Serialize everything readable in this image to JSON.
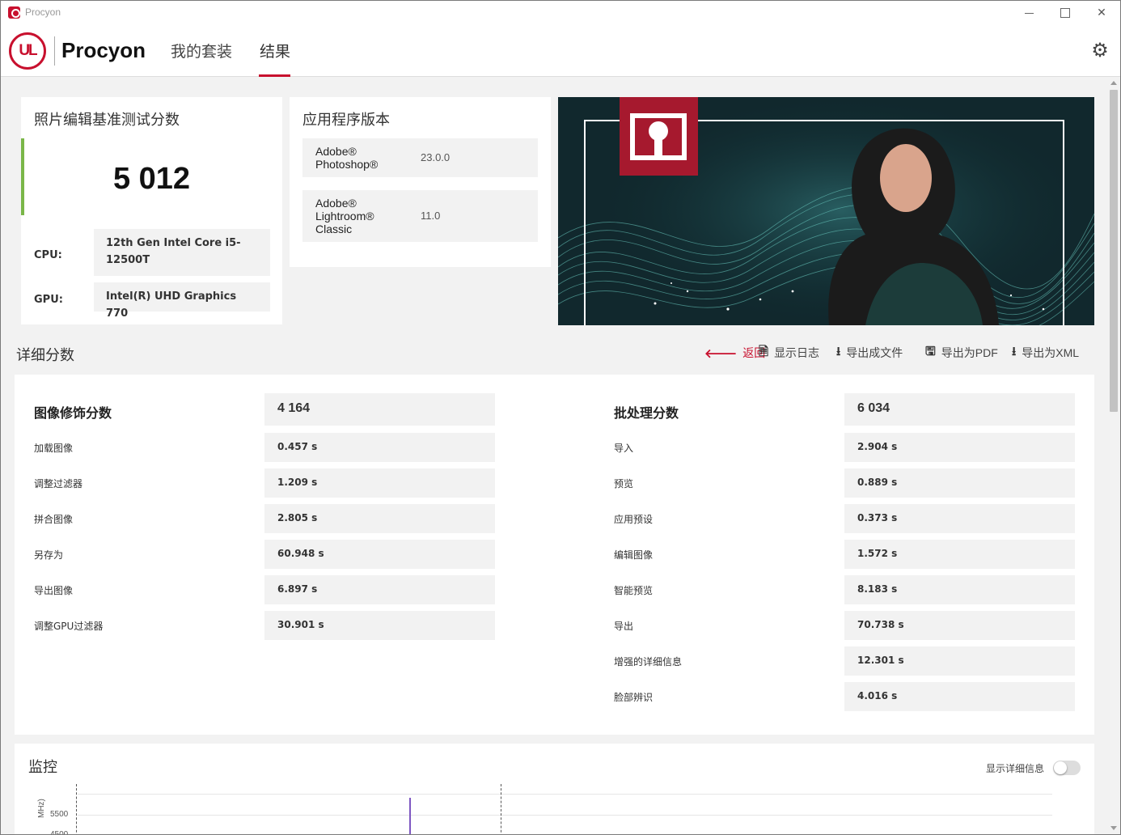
{
  "window": {
    "title": "Procyon"
  },
  "header": {
    "logo_text": "UL",
    "brand": "Procyon",
    "tabs": [
      {
        "label": "我的套装",
        "active": false
      },
      {
        "label": "结果",
        "active": true
      }
    ]
  },
  "score_card": {
    "title": "照片编辑基准测试分数",
    "score": "5 012",
    "cpu_label": "CPU:",
    "cpu_value": "12th Gen Intel Core i5-12500T",
    "gpu_label": "GPU:",
    "gpu_value": "Intel(R) UHD Graphics 770"
  },
  "app_card": {
    "title": "应用程序版本",
    "apps": [
      {
        "name": "Adobe® Photoshop®",
        "version": "23.0.0"
      },
      {
        "name": "Adobe® Lightroom® Classic",
        "version": "11.0"
      }
    ]
  },
  "details": {
    "title": "详细分数",
    "toolbar": {
      "back": "返回",
      "show_log": "显示日志",
      "export_file": "导出成文件",
      "export_pdf": "导出为PDF",
      "export_xml": "导出为XML"
    },
    "retouch": {
      "heading": "图像修饰分数",
      "score": "4 164",
      "rows": [
        {
          "label": "加载图像",
          "value": "0.457 s"
        },
        {
          "label": "调整过滤器",
          "value": "1.209 s"
        },
        {
          "label": "拼合图像",
          "value": "2.805 s"
        },
        {
          "label": "另存为",
          "value": "60.948 s"
        },
        {
          "label": "导出图像",
          "value": "6.897 s"
        },
        {
          "label": "调整GPU过滤器",
          "value": "30.901 s"
        }
      ]
    },
    "batch": {
      "heading": "批处理分数",
      "score": "6 034",
      "rows": [
        {
          "label": "导入",
          "value": "2.904 s"
        },
        {
          "label": "预览",
          "value": "0.889 s"
        },
        {
          "label": "应用预设",
          "value": "0.373 s"
        },
        {
          "label": "编辑图像",
          "value": "1.572 s"
        },
        {
          "label": "智能预览",
          "value": "8.183 s"
        },
        {
          "label": "导出",
          "value": "70.738 s"
        },
        {
          "label": "增强的详细信息",
          "value": "12.301 s"
        },
        {
          "label": "脸部辨识",
          "value": "4.016 s"
        }
      ]
    }
  },
  "monitor": {
    "title": "监控",
    "toggle_label": "显示详细信息",
    "toggle_on": false,
    "y_tick_1": "5500",
    "y_tick_2": "4500",
    "y_axis_label": "MHz)"
  },
  "colors": {
    "accent": "#c8102e",
    "score_bar": "#7ab648",
    "chart_spike": "#7e57c2"
  }
}
